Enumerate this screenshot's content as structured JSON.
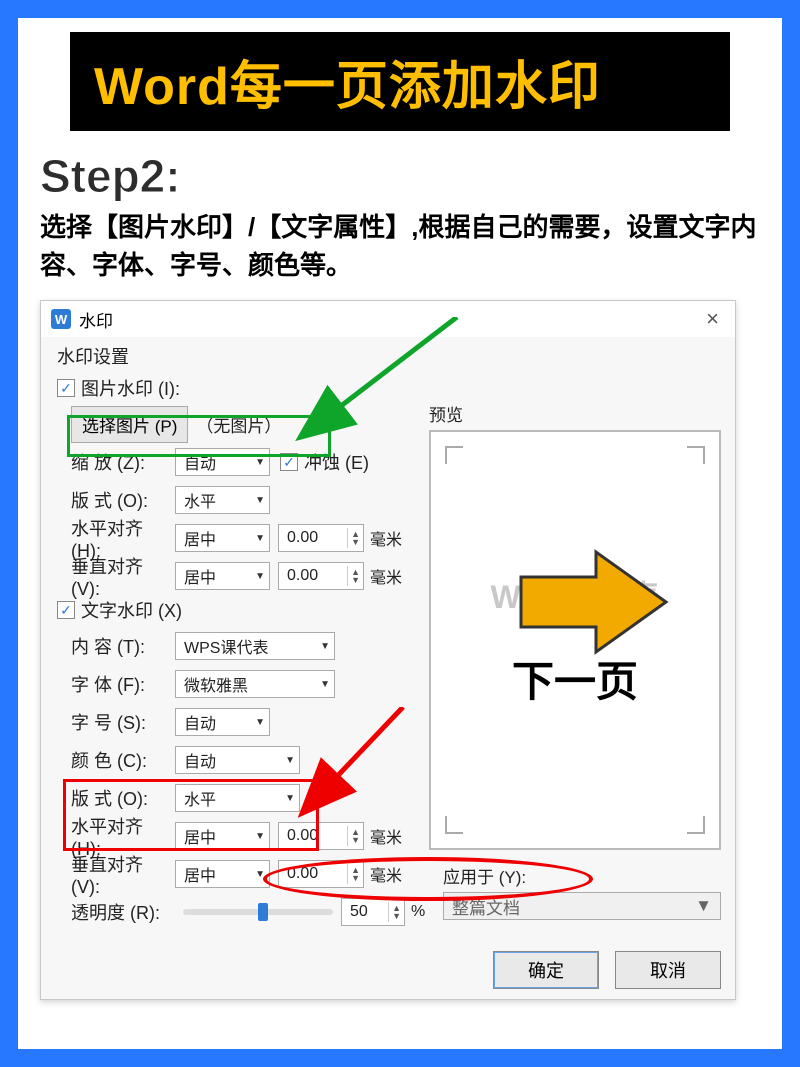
{
  "header": {
    "title": "Word每一页添加水印"
  },
  "step": {
    "label": "Step2:",
    "desc": "选择【图片水印】/【文字属性】,根据自己的需要，设置文字内容、字体、字号、颜色等。"
  },
  "dialog": {
    "title": "水印",
    "section_title": "水印设置",
    "close": "×",
    "image_wm": {
      "checkbox_label": "图片水印 (I):",
      "select_btn": "选择图片 (P)",
      "no_image": "（无图片）",
      "zoom_label": "缩   放 (Z):",
      "zoom_value": "自动",
      "erode_label": "冲蚀 (E)",
      "layout_label": "版   式 (O):",
      "layout_value": "水平",
      "halign_label": "水平对齐 (H):",
      "halign_value": "居中",
      "halign_num": "0.00",
      "halign_unit": "毫米",
      "valign_label": "垂直对齐 (V):",
      "valign_value": "居中",
      "valign_num": "0.00",
      "valign_unit": "毫米"
    },
    "text_wm": {
      "checkbox_label": "文字水印 (X)",
      "content_label": "内   容 (T):",
      "content_value": "WPS课代表",
      "font_label": "字   体 (F):",
      "font_value": "微软雅黑",
      "size_label": "字   号 (S):",
      "size_value": "自动",
      "color_label": "颜   色 (C):",
      "color_value": "自动",
      "layout_label": "版   式 (O):",
      "layout_value": "水平",
      "halign_label": "水平对齐 (H):",
      "halign_value": "居中",
      "halign_num": "0.00",
      "halign_unit": "毫米",
      "valign_label": "垂直对齐 (V):",
      "valign_value": "居中",
      "valign_num": "0.00",
      "valign_unit": "毫米",
      "opacity_label": "透明度 (R):",
      "opacity_value": "50",
      "opacity_unit": "%"
    },
    "preview": {
      "label": "预览",
      "watermark_text": "WPS课代表",
      "next_page": "下一页"
    },
    "apply": {
      "label": "应用于 (Y):",
      "value": "整篇文档"
    },
    "footer": {
      "ok": "确定",
      "cancel": "取消"
    }
  }
}
